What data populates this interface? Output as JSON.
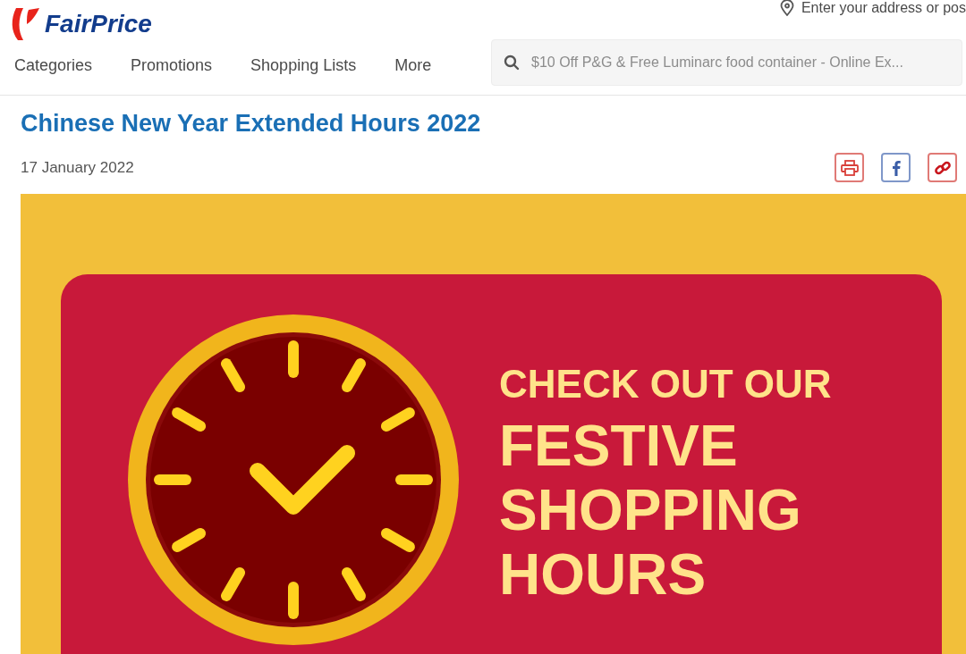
{
  "header": {
    "logo": "FairPrice",
    "address_placeholder": "Enter your address or pos",
    "nav": [
      "Categories",
      "Promotions",
      "Shopping Lists",
      "More"
    ],
    "search": {
      "placeholder": "$10 Off P&G & Free Luminarc food container - Online Ex..."
    }
  },
  "article": {
    "title": "Chinese New Year Extended Hours 2022",
    "date": "17 January 2022",
    "share": [
      {
        "kind": "print"
      },
      {
        "kind": "facebook"
      },
      {
        "kind": "link"
      }
    ],
    "banner": {
      "lines": [
        "CHECK OUT OUR",
        "FESTIVE",
        "SHOPPING",
        "HOURS"
      ]
    }
  }
}
